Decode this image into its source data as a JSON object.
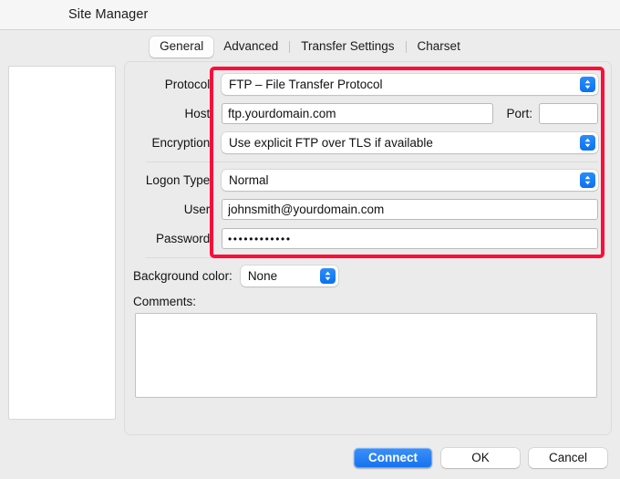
{
  "window": {
    "title": "Site Manager"
  },
  "tabs": [
    {
      "label": "General",
      "active": true
    },
    {
      "label": "Advanced",
      "active": false
    },
    {
      "label": "Transfer Settings",
      "active": false
    },
    {
      "label": "Charset",
      "active": false
    }
  ],
  "sitelist": {
    "items": []
  },
  "form": {
    "protocol": {
      "label": "Protocol:",
      "value": "FTP – File Transfer Protocol"
    },
    "host": {
      "label": "Host:",
      "value": "ftp.yourdomain.com",
      "placeholder": ""
    },
    "port": {
      "label": "Port:",
      "value": "",
      "placeholder": ""
    },
    "encryption": {
      "label": "Encryption:",
      "value": "Use explicit FTP over TLS if available"
    },
    "logon_type": {
      "label": "Logon Type:",
      "value": "Normal"
    },
    "user": {
      "label": "User:",
      "value": "johnsmith@yourdomain.com",
      "placeholder": ""
    },
    "password": {
      "label": "Password:",
      "value": "••••••••••••",
      "placeholder": ""
    },
    "background_color": {
      "label": "Background color:",
      "value": "None"
    },
    "comments": {
      "label": "Comments:",
      "value": "",
      "placeholder": ""
    }
  },
  "footer": {
    "connect_label": "Connect",
    "ok_label": "OK",
    "cancel_label": "Cancel"
  },
  "annotation": {
    "highlight_color": "#fc0d3a"
  },
  "icons": {
    "stepper": "up-down-chevron-icon"
  }
}
